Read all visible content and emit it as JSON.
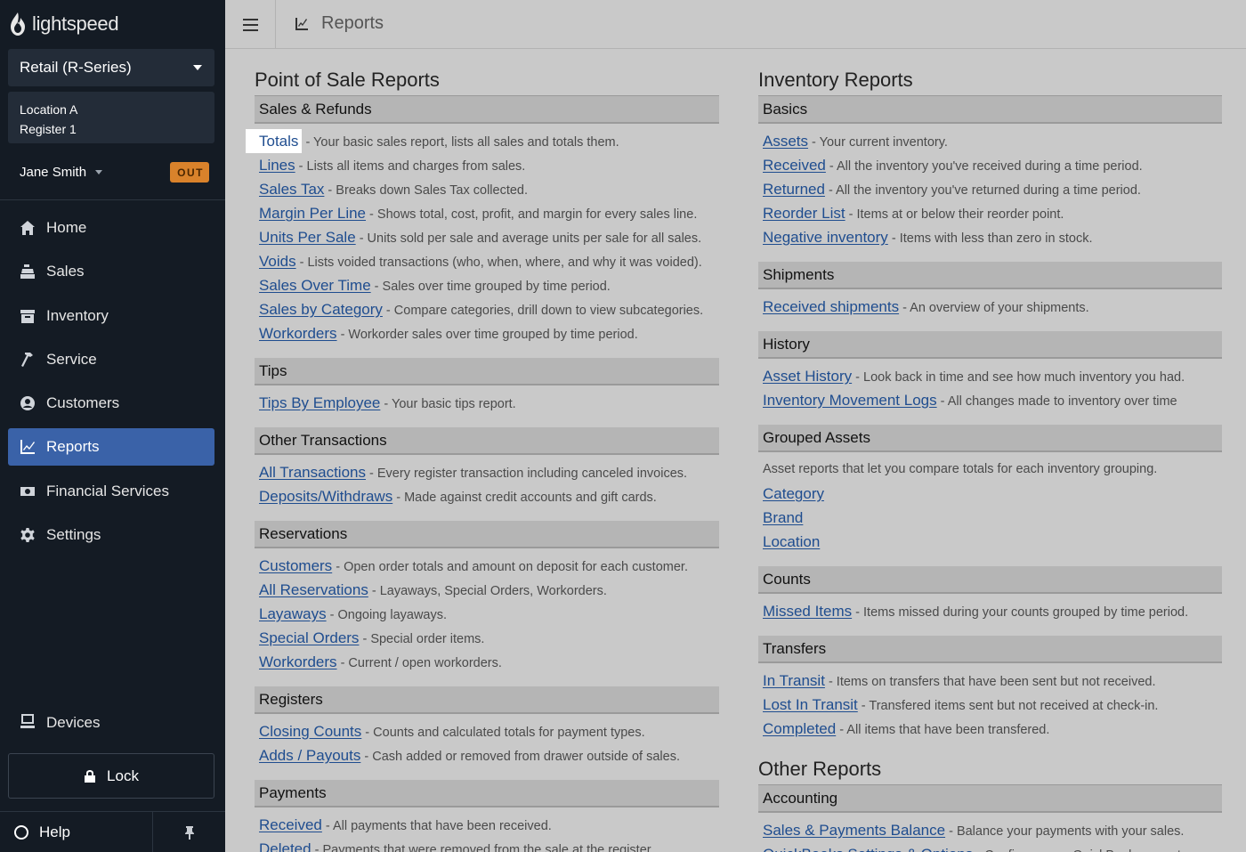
{
  "brand": "lightspeed",
  "shop_select": "Retail (R-Series)",
  "location": {
    "line1": "Location A",
    "line2": "Register 1"
  },
  "user": {
    "name": "Jane Smith",
    "status": "OUT"
  },
  "nav": [
    {
      "label": "Home",
      "icon": "home-icon"
    },
    {
      "label": "Sales",
      "icon": "register-icon"
    },
    {
      "label": "Inventory",
      "icon": "inventory-icon"
    },
    {
      "label": "Service",
      "icon": "hammer-icon"
    },
    {
      "label": "Customers",
      "icon": "customer-icon"
    },
    {
      "label": "Reports",
      "icon": "chart-icon",
      "active": true
    },
    {
      "label": "Financial Services",
      "icon": "money-icon"
    },
    {
      "label": "Settings",
      "icon": "gear-icon"
    }
  ],
  "devices": "Devices",
  "lock": "Lock",
  "help": "Help",
  "topbar": {
    "title": "Reports"
  },
  "left": {
    "title": "Point of Sale Reports",
    "sections": [
      {
        "name": "Sales & Refunds",
        "rows": [
          {
            "link": "Totals",
            "desc": " - Your basic sales report, lists all sales and totals them.",
            "highlight": true
          },
          {
            "link": "Lines",
            "desc": " - Lists all items and charges from sales."
          },
          {
            "link": "Sales Tax",
            "desc": " - Breaks down Sales Tax collected."
          },
          {
            "link": "Margin Per Line",
            "desc": " - Shows total, cost, profit, and margin for every sales line."
          },
          {
            "link": "Units Per Sale",
            "desc": " - Units sold per sale and average units per sale for all sales."
          },
          {
            "link": "Voids",
            "desc": " - Lists voided transactions (who, when, where, and why it was voided)."
          },
          {
            "link": "Sales Over Time",
            "desc": " - Sales over time grouped by time period."
          },
          {
            "link": "Sales by Category",
            "desc": " - Compare categories, drill down to view subcategories."
          },
          {
            "link": "Workorders",
            "desc": " - Workorder sales over time grouped by time period."
          }
        ]
      },
      {
        "name": "Tips",
        "rows": [
          {
            "link": "Tips By Employee",
            "desc": " - Your basic tips report."
          }
        ]
      },
      {
        "name": "Other Transactions",
        "rows": [
          {
            "link": "All Transactions",
            "desc": " - Every register transaction including canceled invoices."
          },
          {
            "link": "Deposits/Withdraws",
            "desc": " - Made against credit accounts and gift cards."
          }
        ]
      },
      {
        "name": "Reservations",
        "rows": [
          {
            "link": "Customers",
            "desc": " - Open order totals and amount on deposit for each customer."
          },
          {
            "link": "All Reservations",
            "desc": " - Layaways, Special Orders, Workorders."
          },
          {
            "link": "Layaways",
            "desc": " - Ongoing layaways."
          },
          {
            "link": "Special Orders",
            "desc": " - Special order items."
          },
          {
            "link": "Workorders",
            "desc": " - Current / open workorders."
          }
        ]
      },
      {
        "name": "Registers",
        "rows": [
          {
            "link": "Closing Counts",
            "desc": " - Counts and calculated totals for payment types."
          },
          {
            "link": "Adds / Payouts",
            "desc": " - Cash added or removed from drawer outside of sales."
          }
        ]
      },
      {
        "name": "Payments",
        "rows": [
          {
            "link": "Received",
            "desc": " - All payments that have been received."
          },
          {
            "link": "Deleted",
            "desc": " - Payments that were removed from the sale at the register."
          }
        ]
      }
    ]
  },
  "right": {
    "title": "Inventory Reports",
    "sections": [
      {
        "name": "Basics",
        "rows": [
          {
            "link": "Assets",
            "desc": " - Your current inventory."
          },
          {
            "link": "Received",
            "desc": " - All the inventory you've received during a time period."
          },
          {
            "link": "Returned",
            "desc": " - All the inventory you've returned during a time period."
          },
          {
            "link": "Reorder List",
            "desc": " - Items at or below their reorder point."
          },
          {
            "link": "Negative inventory",
            "desc": " - Items with less than zero in stock."
          }
        ]
      },
      {
        "name": "Shipments",
        "rows": [
          {
            "link": "Received shipments",
            "desc": " - An overview of your shipments."
          }
        ]
      },
      {
        "name": "History",
        "rows": [
          {
            "link": "Asset History",
            "desc": " - Look back in time and see how much inventory you had."
          },
          {
            "link": "Inventory Movement Logs",
            "desc": " - All changes made to inventory over time"
          }
        ]
      },
      {
        "name": "Grouped Assets",
        "intro": "Asset reports that let you compare totals for each inventory grouping.",
        "rows": [
          {
            "link": "Category",
            "desc": ""
          },
          {
            "link": "Brand",
            "desc": ""
          },
          {
            "link": "Location",
            "desc": ""
          }
        ]
      },
      {
        "name": "Counts",
        "rows": [
          {
            "link": "Missed Items",
            "desc": " - Items missed during your counts grouped by time period."
          }
        ]
      },
      {
        "name": "Transfers",
        "rows": [
          {
            "link": "In Transit",
            "desc": " - Items on transfers that have been sent but not received."
          },
          {
            "link": "Lost In Transit",
            "desc": " - Transfered items sent but not received at check-in."
          },
          {
            "link": "Completed",
            "desc": " - All items that have been transfered."
          }
        ]
      }
    ],
    "other_title": "Other Reports",
    "other_sections": [
      {
        "name": "Accounting",
        "rows": [
          {
            "link": "Sales & Payments Balance",
            "desc": " - Balance your payments with your sales."
          },
          {
            "link": "QuickBooks Settings & Options",
            "desc": " - Configure your QuickBooks exports."
          }
        ]
      }
    ]
  }
}
